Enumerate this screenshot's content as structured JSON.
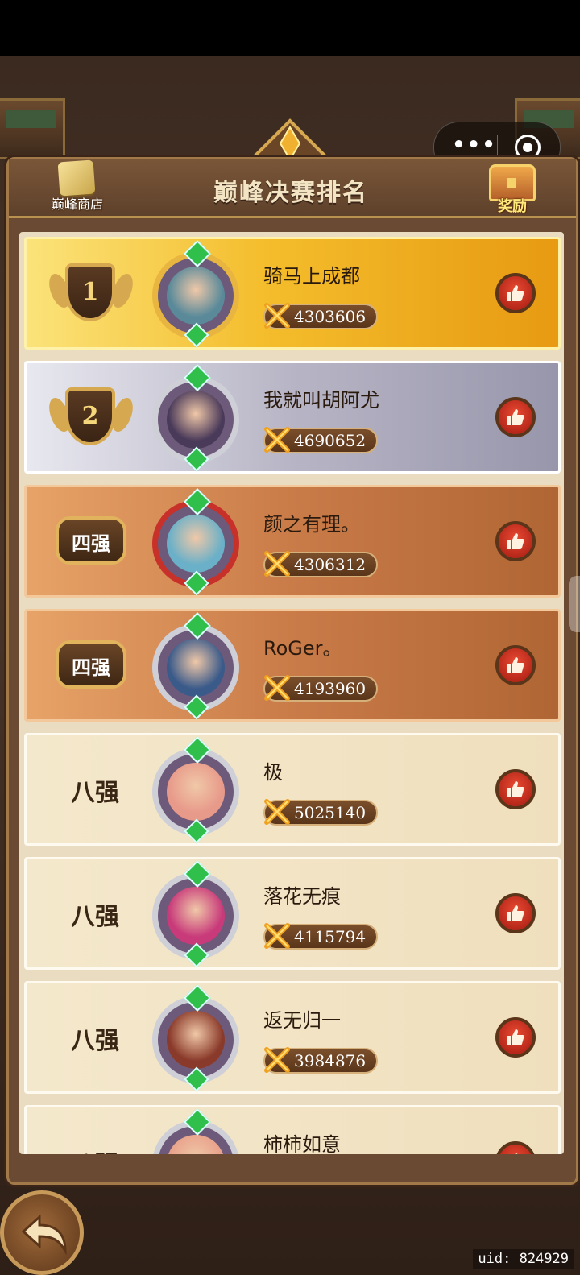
{
  "header": {
    "title": "巅峰决赛排名",
    "shop_label": "巅峰商店",
    "reward_label": "奖励"
  },
  "colors": {
    "gold": "#f4bd2c",
    "silver": "#b7b5c5",
    "bronze": "#c97b48",
    "plain": "#efdfbd",
    "like": "#c8301f"
  },
  "rankings": [
    {
      "rank_label": "1",
      "tier": "gold",
      "name": "骑马上成都",
      "score": "4303606"
    },
    {
      "rank_label": "2",
      "tier": "silver",
      "name": "我就叫胡阿尤",
      "score": "4690652"
    },
    {
      "rank_label": "四强",
      "tier": "bronze",
      "name": "颜之有理。",
      "score": "4306312"
    },
    {
      "rank_label": "四强",
      "tier": "bronze",
      "name": "RoGer。",
      "score": "4193960"
    },
    {
      "rank_label": "八强",
      "tier": "plain",
      "name": "极",
      "score": "5025140"
    },
    {
      "rank_label": "八强",
      "tier": "plain",
      "name": "落花无痕",
      "score": "4115794"
    },
    {
      "rank_label": "八强",
      "tier": "plain",
      "name": "返无归一",
      "score": "3984876"
    },
    {
      "rank_label": "八强",
      "tier": "plain",
      "name": "柿柿如意",
      "score": ""
    }
  ],
  "footer": {
    "uid": "uid: 824929"
  },
  "icons": {
    "back": "back-arrow-icon",
    "like": "thumbs-up-icon",
    "menu": "more-dots-icon",
    "close": "target-close-icon"
  }
}
